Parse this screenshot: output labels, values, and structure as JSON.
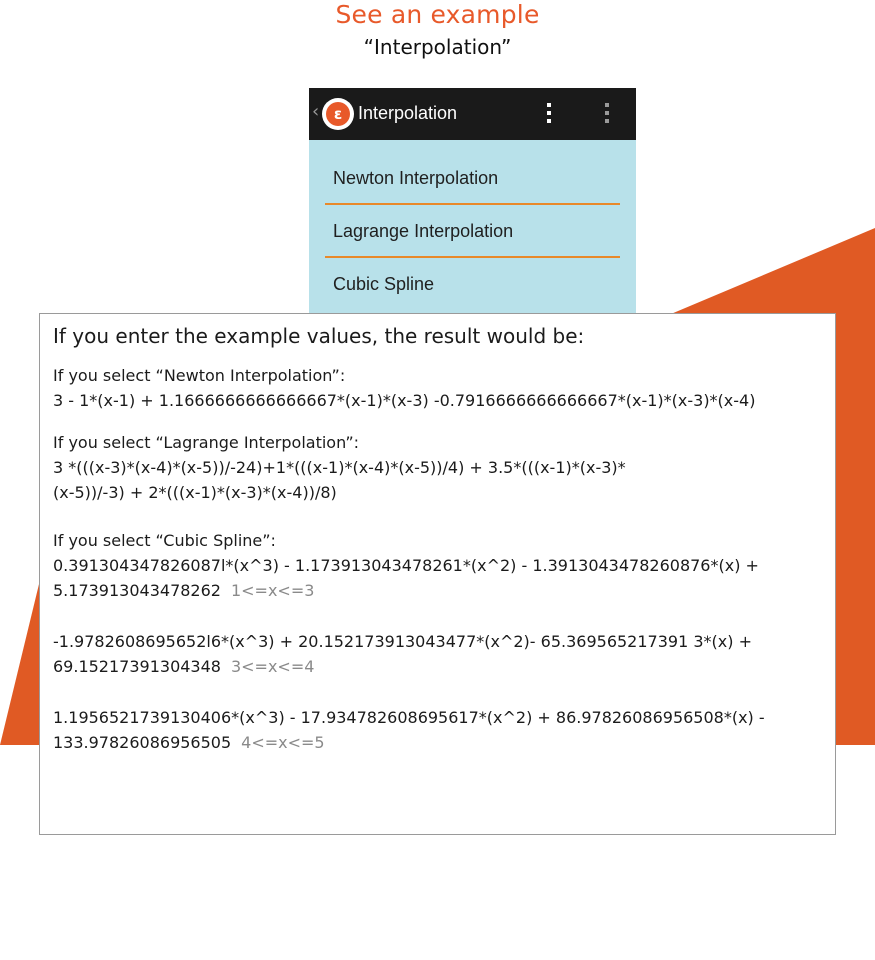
{
  "header": {
    "title": "See an example",
    "subtitle": "“Interpolation”"
  },
  "phone": {
    "back_glyph": "‹",
    "app_icon_letter": "ε",
    "title": "Interpolation",
    "menu": [
      {
        "label": "Newton Interpolation"
      },
      {
        "label": "Lagrange Interpolation"
      },
      {
        "label": "Cubic Spline"
      }
    ]
  },
  "result": {
    "intro": "If you enter the example values, the result would be:",
    "newton_label": "If you select “Newton Interpolation”:",
    "newton_eq": "3 - 1*(x-1) + 1.1666666666666667*(x-1)*(x-3) -0.7916666666666667*(x-1)*(x-3)*(x-4)",
    "lagrange_label": "If you select “Lagrange Interpolation”:",
    "lagrange_eq_line1": "3 *(((x-3)*(x-4)*(x-5))/-24)+1*(((x-1)*(x-4)*(x-5))/4) + 3.5*(((x-1)*(x-3)*",
    "lagrange_eq_line2": "(x-5))/-3) + 2*(((x-1)*(x-3)*(x-4))/8)",
    "spline_label": "If you select “Cubic Spline”:",
    "spline": [
      {
        "line1": "0.391304347826087l*(x^3) - 1.173913043478261*(x^2) - 1.3913043478260876*(x) +",
        "line2": "5.173913043478262",
        "range": "1<=x<=3"
      },
      {
        "line1": "-1.9782608695652l6*(x^3) + 20.152173913043477*(x^2)- 65.369565217391 3*(x) +",
        "line2": "69.15217391304348",
        "range": "3<=x<=4"
      },
      {
        "line1": "1.1956521739130406*(x^3) - 17.934782608695617*(x^2) + 86.97826086956508*(x) -",
        "line2": "133.97826086956505",
        "range": "4<=x<=5"
      }
    ]
  },
  "colors": {
    "accent_orange": "#e8592a",
    "divider_orange": "#e8892a",
    "phone_bg": "#b8e1ea",
    "actionbar": "#1a1a1a",
    "range_gray": "#8a8a8a"
  },
  "icons": {
    "back": "chevron-left-icon",
    "app": "app-logo-icon",
    "menu1": "overflow-menu-icon",
    "menu2": "overflow-menu-icon"
  }
}
